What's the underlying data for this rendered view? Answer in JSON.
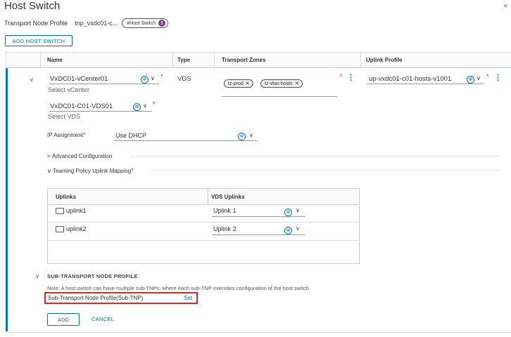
{
  "dialog": {
    "title": "Host Switch",
    "close_glyph": "×"
  },
  "profile": {
    "label": "Transport Node Profile",
    "value": "tnp_vxdc01-c...",
    "badge": "#Host Switch",
    "badge_count": "1"
  },
  "toolbar": {
    "add_host_switch": "ADD HOST SWITCH"
  },
  "grid": {
    "headers": {
      "name": "Name",
      "type": "Type",
      "transport_zones": "Transport Zones",
      "uplink_profile": "Uplink Profile"
    }
  },
  "row": {
    "vcenter": {
      "value": "VxDC01-vCenter01",
      "helper": "Select vCenter"
    },
    "vds": {
      "value": "VxDC01-C01-VDS01",
      "helper": "Select VDS"
    },
    "type": "VDS",
    "transport_zones": [
      "tz-prod",
      "tz-vlan-hosts"
    ],
    "uplink_profile": "up-vxdc01-c01-hosts-v1001",
    "ip_assignment": {
      "label": "IP Assignment",
      "value": "Use DHCP"
    },
    "advanced_config": "Advanced Configuration",
    "teaming": "Teaming Policy Uplink Mapping",
    "uplinks_table": {
      "headers": {
        "uplinks": "Uplinks",
        "vds_uplinks": "VDS Uplinks"
      },
      "rows": [
        {
          "uplink": "uplink1",
          "vds_uplink": "Uplink 1"
        },
        {
          "uplink": "uplink2",
          "vds_uplink": "Uplink 2"
        }
      ]
    },
    "sub_tnp": {
      "section": "SUB-TRANSPORT NODE PROFILE",
      "note": "Note: A host switch can have multiple sub-TNPs, where each sub-TNP overrides configuration of the host switch.",
      "label": "Sub-Transport Node Profile(Sub-TNP)",
      "action": "Set"
    },
    "actions": {
      "add": "ADD",
      "cancel": "CANCEL"
    }
  },
  "icons": {
    "clear": "⊗",
    "caret": "∨",
    "kebab": "⋮",
    "expand": "∨",
    "collapsed": ">"
  },
  "colors": {
    "accent": "#0072a3",
    "required": "#e12200",
    "highlight": "#d5282a",
    "badge": "#6b3d9a"
  }
}
